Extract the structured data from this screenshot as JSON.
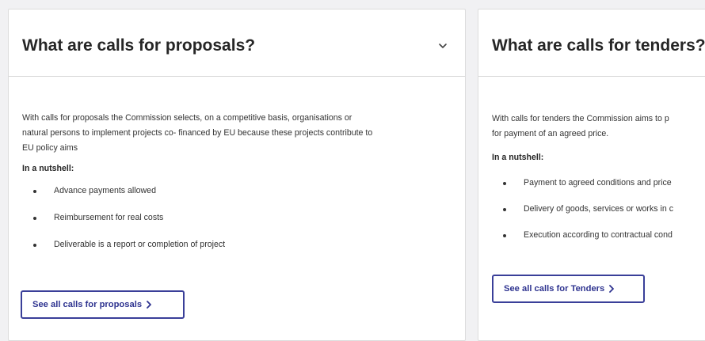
{
  "proposals": {
    "title": "What are calls for proposals?",
    "description_lines": [
      "With calls for proposals the Commission selects, on a competitive basis, organisations or",
      "natural persons to implement projects co- financed by EU because these projects contribute to",
      "EU policy aims"
    ],
    "nutshell_label": "In a nutshell:",
    "items": [
      "Advance payments allowed",
      "Reimbursement for real costs",
      "Deliverable is a report or completion of project"
    ],
    "button_label": "See all calls for proposals"
  },
  "tenders": {
    "title": "What are calls for tenders?",
    "description_lines": [
      "With calls for tenders the Commission aims to p",
      "for payment of an agreed price."
    ],
    "nutshell_label": "In a nutshell:",
    "items": [
      "Payment to agreed conditions and price",
      "Delivery of goods, services or works in c",
      "Execution according to contractual cond"
    ],
    "button_label": "See all calls for Tenders"
  },
  "icons": {
    "expand": "chevron-down-icon",
    "button_arrow": "chevron-right-icon"
  },
  "colors": {
    "page_background": "#f1f1f3",
    "card_background": "#ffffff",
    "button_border": "#3a3f99",
    "button_text": "#2f3490"
  }
}
